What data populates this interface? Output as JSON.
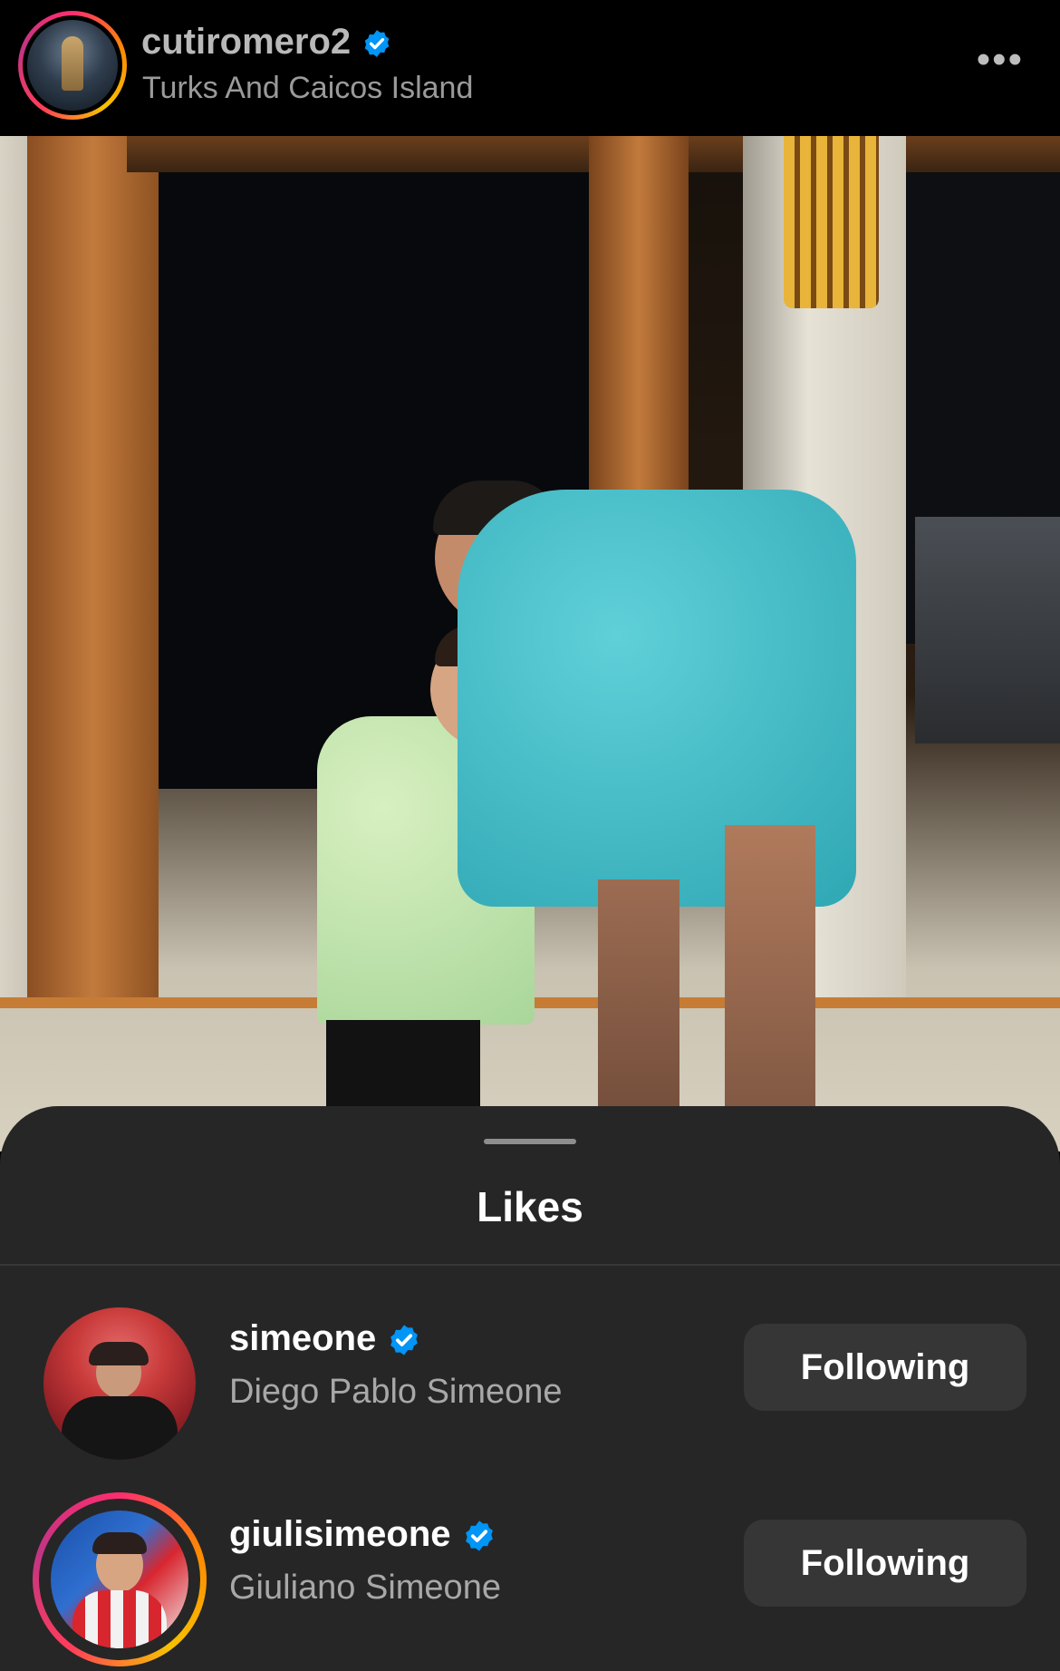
{
  "post": {
    "username": "cutiromero2",
    "location": "Turks And Caicos Island",
    "more_label": "•••"
  },
  "likes_sheet": {
    "title": "Likes",
    "users": [
      {
        "username": "simeone",
        "full_name": "Diego Pablo Simeone",
        "button_label": "Following",
        "verified": true,
        "story_ring": false
      },
      {
        "username": "giulisimeone",
        "full_name": "Giuliano Simeone",
        "button_label": "Following",
        "verified": true,
        "story_ring": true
      }
    ]
  },
  "colors": {
    "background": "#000000",
    "sheet": "#262626",
    "button": "#363636",
    "verified_badge": "#0095f6",
    "secondary_text": "#a8a8a8"
  },
  "icons": [
    "verified-badge-icon",
    "more-options-icon"
  ]
}
